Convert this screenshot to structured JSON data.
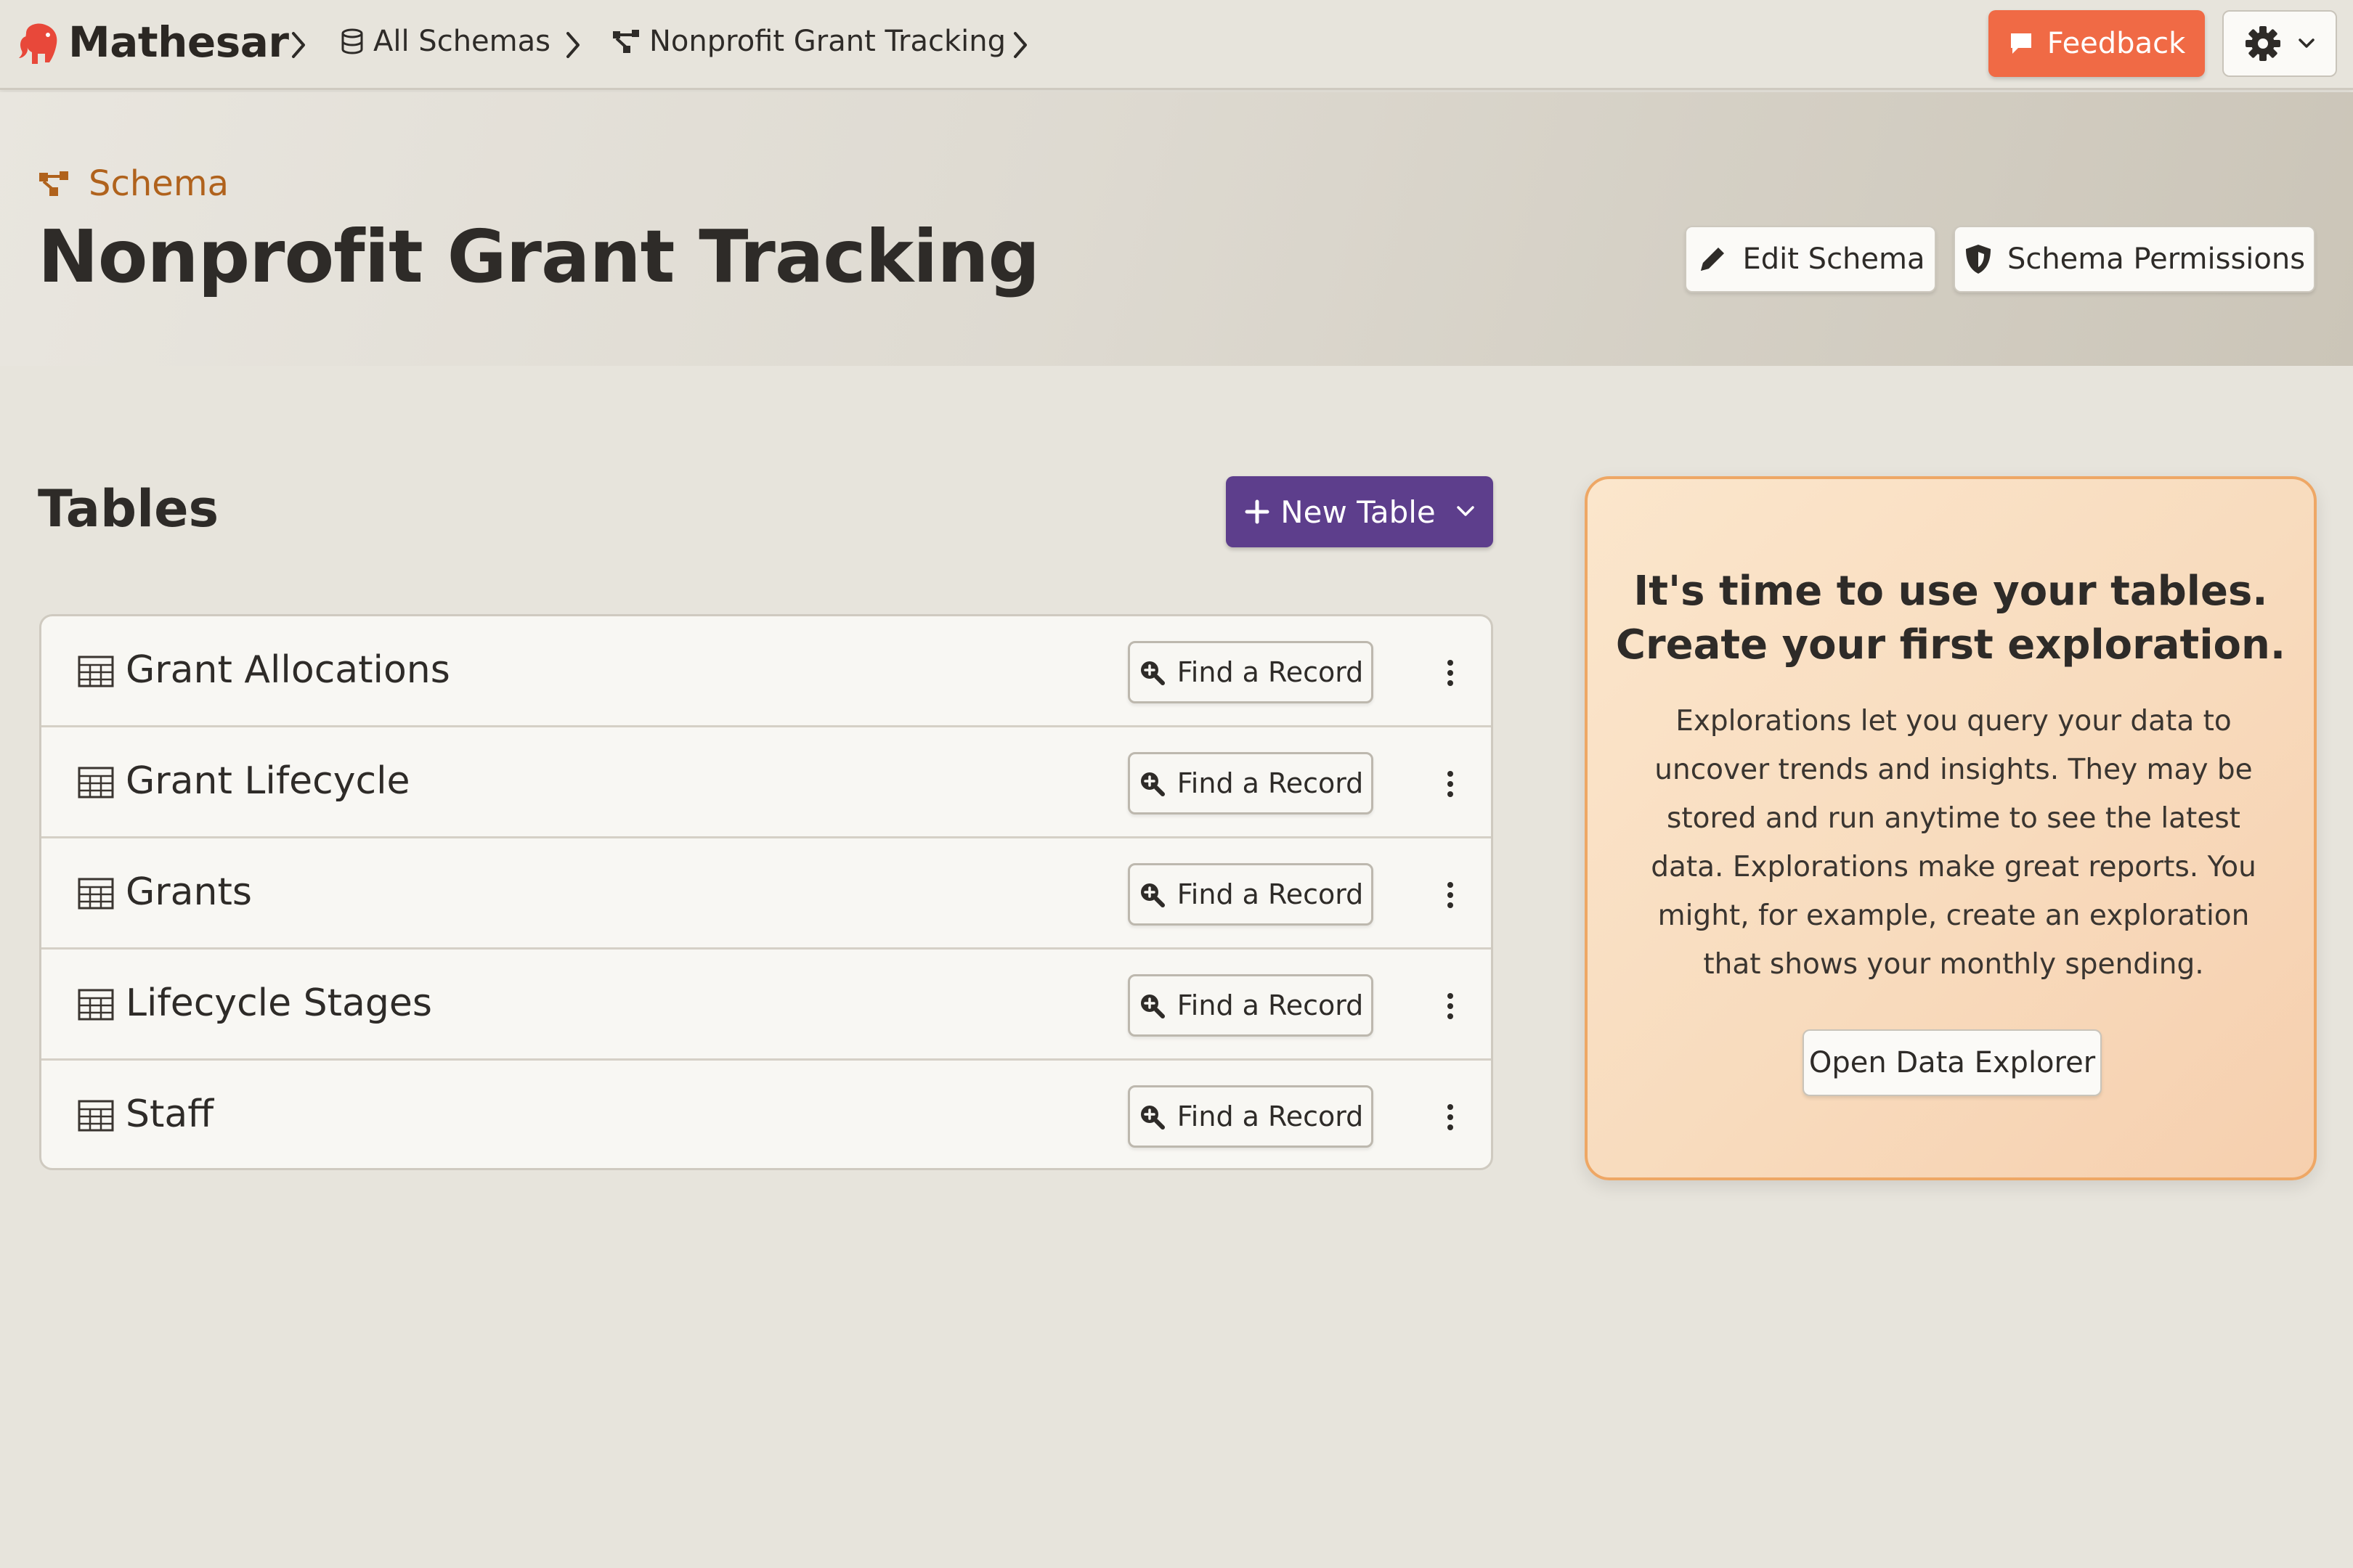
{
  "app": {
    "brand": "Mathesar"
  },
  "breadcrumb": {
    "items": [
      {
        "label": "All Schemas",
        "icon": "database-icon"
      },
      {
        "label": "Nonprofit Grant Tracking",
        "icon": "schema-icon"
      }
    ]
  },
  "topbar": {
    "feedback_label": "Feedback",
    "feedback_color": "#f06a45",
    "settings_icon": "gear-icon"
  },
  "header": {
    "kicker": "Schema",
    "kicker_color": "#b0621c",
    "title": "Nonprofit Grant Tracking",
    "edit_label": "Edit Schema",
    "permissions_label": "Schema Permissions"
  },
  "tables_section": {
    "heading": "Tables",
    "new_table_label": "New Table",
    "new_table_color": "#5d3e8c",
    "find_label": "Find a Record",
    "items": [
      {
        "name": "Grant Allocations"
      },
      {
        "name": "Grant Lifecycle"
      },
      {
        "name": "Grants"
      },
      {
        "name": "Lifecycle Stages"
      },
      {
        "name": "Staff"
      }
    ]
  },
  "explore_card": {
    "title_line1": "It's time to use your tables.",
    "title_line2": "Create your first exploration.",
    "body": "Explorations let you query your data to uncover trends and insights. They may be stored and run anytime to see the latest data. Explorations make great reports. You might, for example, create an exploration that shows your monthly spending.",
    "button_label": "Open Data Explorer",
    "border_color": "#eea765"
  }
}
